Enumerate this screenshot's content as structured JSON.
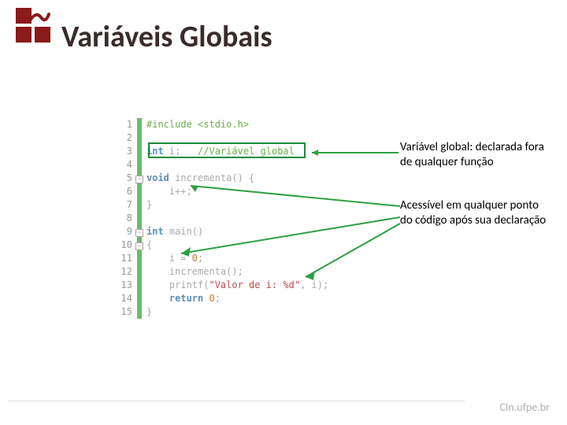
{
  "title": "Variáveis Globais",
  "footer": "CIn.ufpe.br",
  "annotations": {
    "decl": "Variável global: declarada fora de qualquer função",
    "access": "Acessível em qualquer ponto do código após sua declaração"
  },
  "code": {
    "lines": [
      {
        "n": 1,
        "html": "<span class='cm'>#include &lt;stdio.h&gt;</span>"
      },
      {
        "n": 2,
        "html": ""
      },
      {
        "n": 3,
        "html": "<span class='kw'>int</span> i;   <span class='cm'>//Variável global</span>"
      },
      {
        "n": 4,
        "html": ""
      },
      {
        "n": 5,
        "html": "<span class='kw'>void</span> incrementa() {",
        "fold": true
      },
      {
        "n": 6,
        "html": "    i++;"
      },
      {
        "n": 7,
        "html": "}"
      },
      {
        "n": 8,
        "html": ""
      },
      {
        "n": 9,
        "html": "<span class='kw'>int</span> main()",
        "fold": true
      },
      {
        "n": 10,
        "html": "{",
        "fold": true
      },
      {
        "n": 11,
        "html": "    i = <span class='num'>0</span>;"
      },
      {
        "n": 12,
        "html": "    incrementa();"
      },
      {
        "n": 13,
        "html": "    printf(<span class='str'>\"Valor de i: %d\"</span>, i);"
      },
      {
        "n": 14,
        "html": "    <span class='kw'>return</span> <span class='num'>0</span>;"
      },
      {
        "n": 15,
        "html": "}"
      }
    ]
  }
}
